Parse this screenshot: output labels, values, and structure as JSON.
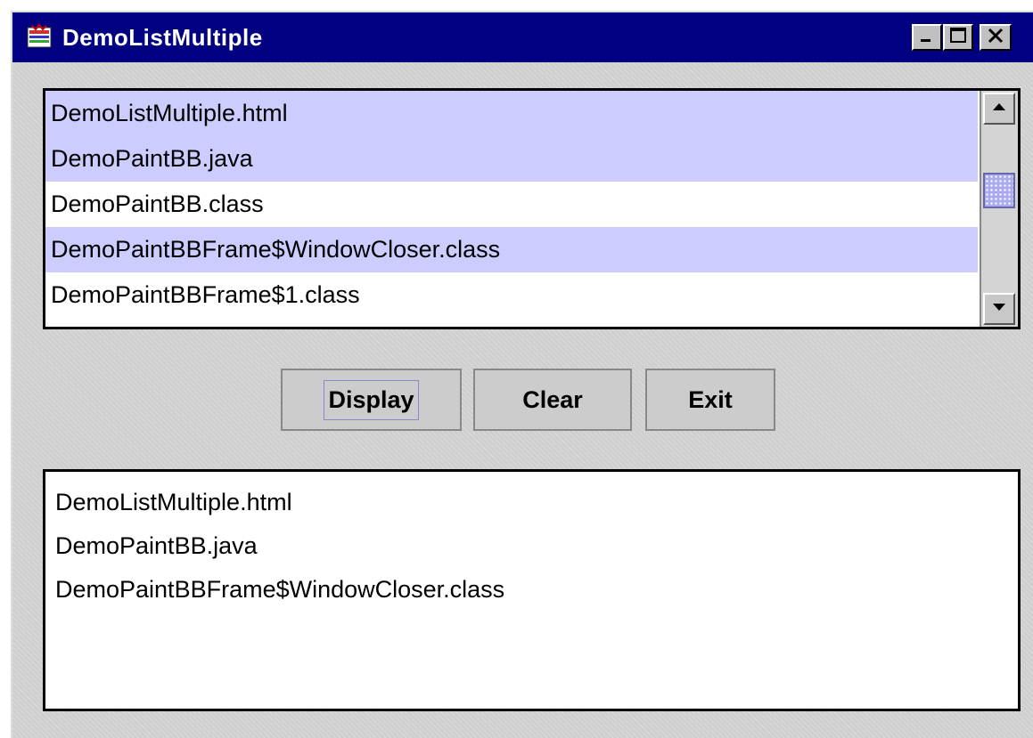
{
  "window": {
    "title": "DemoListMultiple"
  },
  "titlebar_buttons": {
    "minimize_icon": "minimize-icon",
    "maximize_icon": "maximize-icon",
    "close_icon": "close-icon"
  },
  "file_list": {
    "items": [
      {
        "label": "DemoListMultiple.html",
        "selected": true
      },
      {
        "label": "DemoPaintBB.java",
        "selected": true
      },
      {
        "label": "DemoPaintBB.class",
        "selected": false
      },
      {
        "label": "DemoPaintBBFrame$WindowCloser.class",
        "selected": true
      },
      {
        "label": "DemoPaintBBFrame$1.class",
        "selected": false
      }
    ],
    "scroll_position": 0.3
  },
  "buttons": {
    "display_label": "Display",
    "clear_label": "Clear",
    "exit_label": "Exit"
  },
  "output": {
    "lines": [
      "DemoListMultiple.html",
      "DemoPaintBB.java",
      "DemoPaintBBFrame$WindowCloser.class"
    ]
  },
  "colors": {
    "titlebar": "#000080",
    "selection": "#ccccff",
    "background": "#cfcfcf"
  }
}
